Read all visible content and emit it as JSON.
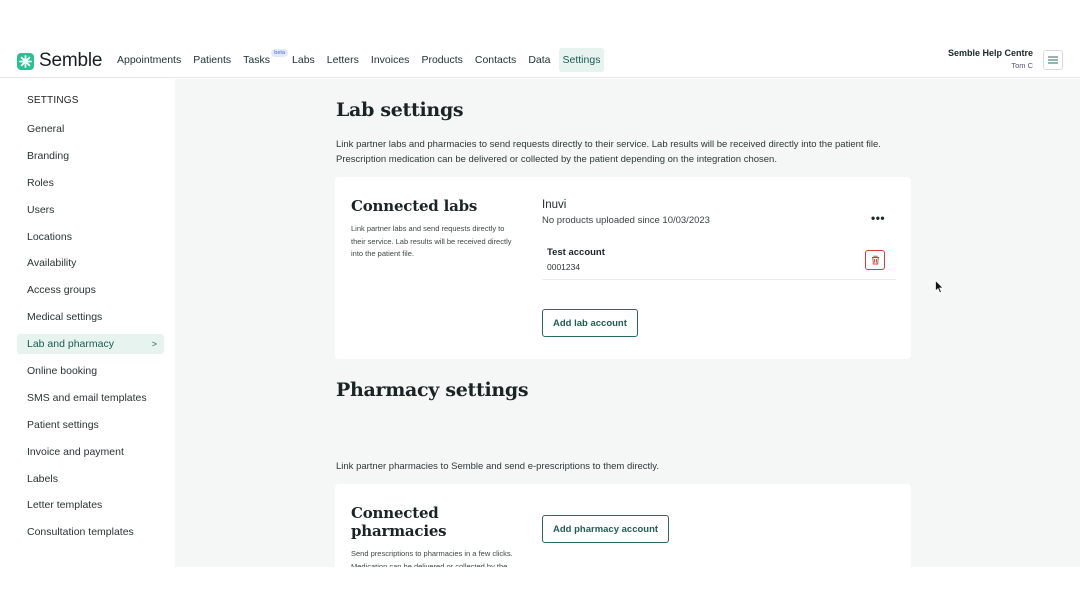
{
  "app": {
    "brand": "Semble",
    "nav": [
      {
        "label": "Appointments"
      },
      {
        "label": "Patients"
      },
      {
        "label": "Tasks",
        "badge": "beta"
      },
      {
        "label": "Labs"
      },
      {
        "label": "Letters"
      },
      {
        "label": "Invoices"
      },
      {
        "label": "Products"
      },
      {
        "label": "Contacts"
      },
      {
        "label": "Data"
      },
      {
        "label": "Settings",
        "active": true
      }
    ],
    "help_centre": "Semble Help Centre",
    "user": "Tom C"
  },
  "sidebar": {
    "heading": "SETTINGS",
    "items": [
      {
        "label": "General"
      },
      {
        "label": "Branding"
      },
      {
        "label": "Roles"
      },
      {
        "label": "Users"
      },
      {
        "label": "Locations"
      },
      {
        "label": "Availability"
      },
      {
        "label": "Access groups"
      },
      {
        "label": "Medical settings"
      },
      {
        "label": "Lab and pharmacy",
        "active": true,
        "chevron": ">"
      },
      {
        "label": "Online booking"
      },
      {
        "label": "SMS and email templates"
      },
      {
        "label": "Patient settings"
      },
      {
        "label": "Invoice and payment"
      },
      {
        "label": "Labels"
      },
      {
        "label": "Letter templates"
      },
      {
        "label": "Consultation templates"
      }
    ]
  },
  "lab_settings": {
    "title": "Lab settings",
    "description": "Link partner labs and pharmacies to send requests directly to their service. Lab results will be received directly into the patient file. Prescription medication can be delivered or collected by the patient depending on the integration chosen.",
    "connected_labs": {
      "title": "Connected labs",
      "description": "Link partner labs and send requests directly to their service. Lab results will be received directly into the patient file.",
      "lab_name": "Inuvi",
      "lab_status": "No products uploaded since 10/03/2023",
      "more_label": "•••",
      "account": {
        "name": "Test account",
        "number": "0001234"
      },
      "add_button": "Add lab account"
    }
  },
  "pharmacy_settings": {
    "title": "Pharmacy settings",
    "description": "Link partner pharmacies to Semble and send e-prescriptions to them directly.",
    "connected_pharmacies": {
      "title": "Connected pharmacies",
      "description": "Send prescriptions to pharmacies in a few clicks. Medication can be delivered or collected by the patient depending on the integration chosen.",
      "add_button": "Add pharmacy account"
    }
  },
  "colors": {
    "accent": "#2bbf94",
    "active_bg": "#e6f3ef",
    "button_border": "#2c6a60",
    "danger": "#d33d3d"
  }
}
